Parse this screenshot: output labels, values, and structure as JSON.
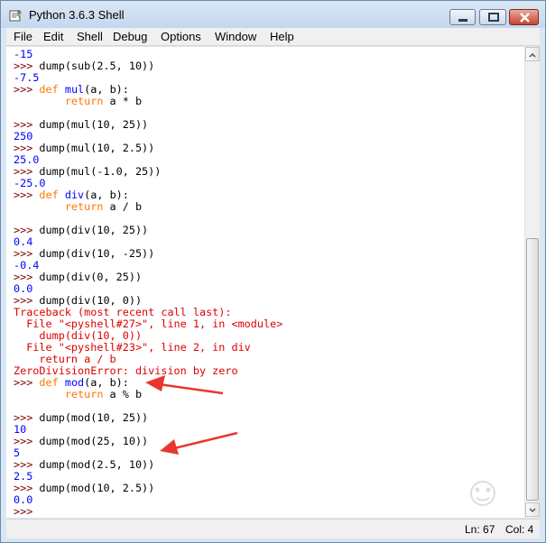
{
  "window": {
    "title": "Python 3.6.3 Shell",
    "icon": "python-idle-icon"
  },
  "menu": [
    "File",
    "Edit",
    "Shell",
    "Debug",
    "Options",
    "Window",
    "Help"
  ],
  "shell_lines": [
    {
      "type": "out",
      "text": "-15"
    },
    {
      "type": "input",
      "text": "dump(sub(2.5, 10))"
    },
    {
      "type": "out",
      "text": "-7.5"
    },
    {
      "type": "def",
      "text": "mul(a, b):"
    },
    {
      "type": "body",
      "text": "return a * b"
    },
    {
      "type": "blank",
      "text": ""
    },
    {
      "type": "input",
      "text": "dump(mul(10, 25))"
    },
    {
      "type": "out",
      "text": "250"
    },
    {
      "type": "input",
      "text": "dump(mul(10, 2.5))"
    },
    {
      "type": "out",
      "text": "25.0"
    },
    {
      "type": "input",
      "text": "dump(mul(-1.0, 25))"
    },
    {
      "type": "out",
      "text": "-25.0"
    },
    {
      "type": "def",
      "text": "div(a, b):"
    },
    {
      "type": "body",
      "text": "return a / b"
    },
    {
      "type": "blank",
      "text": ""
    },
    {
      "type": "input",
      "text": "dump(div(10, 25))"
    },
    {
      "type": "out",
      "text": "0.4"
    },
    {
      "type": "input",
      "text": "dump(div(10, -25))"
    },
    {
      "type": "out",
      "text": "-0.4"
    },
    {
      "type": "input",
      "text": "dump(div(0, 25))"
    },
    {
      "type": "out",
      "text": "0.0"
    },
    {
      "type": "input",
      "text": "dump(div(10, 0))"
    },
    {
      "type": "err",
      "text": "Traceback (most recent call last):"
    },
    {
      "type": "err",
      "text": "  File \"<pyshell#27>\", line 1, in <module>"
    },
    {
      "type": "err",
      "text": "    dump(div(10, 0))"
    },
    {
      "type": "err",
      "text": "  File \"<pyshell#23>\", line 2, in div"
    },
    {
      "type": "err",
      "text": "    return a / b"
    },
    {
      "type": "err",
      "text": "ZeroDivisionError: division by zero"
    },
    {
      "type": "def",
      "text": "mod(a, b):"
    },
    {
      "type": "body",
      "text": "return a % b"
    },
    {
      "type": "blank",
      "text": ""
    },
    {
      "type": "input",
      "text": "dump(mod(10, 25))"
    },
    {
      "type": "out",
      "text": "10"
    },
    {
      "type": "input",
      "text": "dump(mod(25, 10))"
    },
    {
      "type": "out",
      "text": "5"
    },
    {
      "type": "input",
      "text": "dump(mod(2.5, 10))"
    },
    {
      "type": "out",
      "text": "2.5"
    },
    {
      "type": "input",
      "text": "dump(mod(10, 2.5))"
    },
    {
      "type": "out",
      "text": "0.0"
    },
    {
      "type": "prompt",
      "text": ""
    }
  ],
  "prompt": ">>>",
  "keywords": {
    "def": "def",
    "return": "return"
  },
  "status": {
    "line": "Ln: 67",
    "col": "Col: 4"
  },
  "colors": {
    "keyword": "#ff7700",
    "output": "#0000ff",
    "error": "#dd0000",
    "prompt": "#7a0000",
    "arrow": "#e8382e"
  }
}
